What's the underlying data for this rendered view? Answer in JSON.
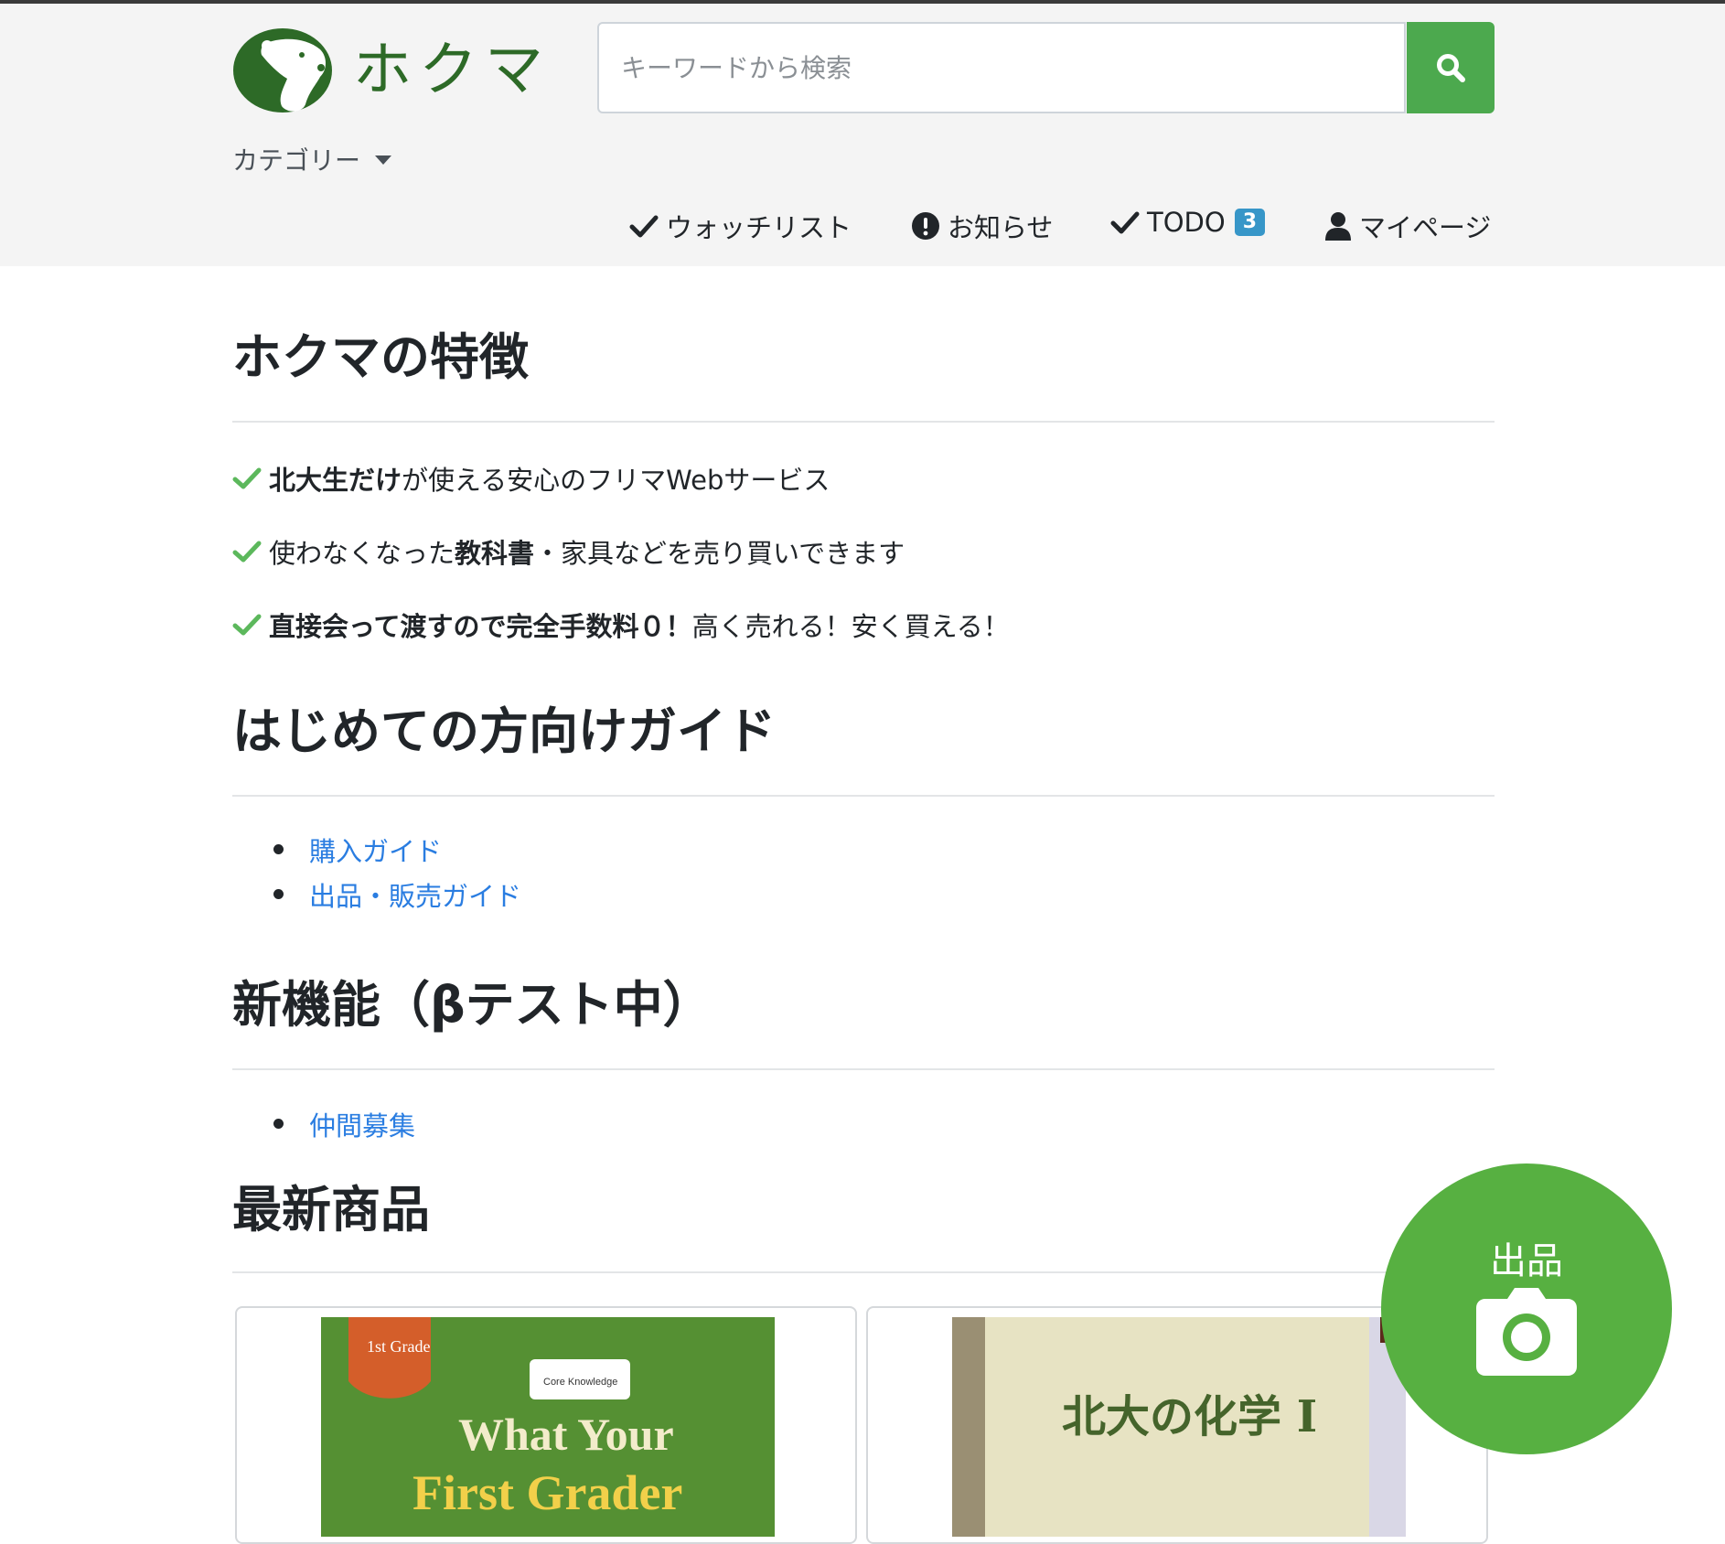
{
  "header": {
    "logo_text": "ホクマ",
    "search_placeholder": "キーワードから検索",
    "search_button_icon": "search-icon",
    "category_label": "カテゴリー"
  },
  "nav": {
    "watchlist": "ウォッチリスト",
    "notices": "お知らせ",
    "todo": "TODO",
    "todo_count": "3",
    "mypage": "マイページ"
  },
  "features": {
    "title": "ホクマの特徴",
    "items": [
      {
        "bold": "北大生だけ",
        "text": "が使える安心のフリマWebサービス"
      },
      {
        "pre": "使わなくなった",
        "bold": "教科書",
        "text": "・家具などを売り買いできます"
      },
      {
        "bold": "直接会って渡すので完全手数料０！",
        "text": "高く売れる！安く買える！"
      }
    ]
  },
  "guide": {
    "title": "はじめての方向けガイド",
    "links": [
      "購入ガイド",
      "出品・販売ガイド"
    ]
  },
  "new_features": {
    "title": "新機能（βテスト中）",
    "links": [
      "仲間募集"
    ]
  },
  "latest": {
    "title": "最新商品",
    "products": [
      {
        "cover_small": "1st Grade",
        "cover_brand": "Core Knowledge",
        "cover_line1": "What Your",
        "cover_line2": "First Grader"
      },
      {
        "cover_title": "北大の化学 I"
      }
    ]
  },
  "fab": {
    "label": "出品",
    "icon": "camera-icon"
  },
  "colors": {
    "brand_green": "#4ca94e",
    "fab_green": "#57b041",
    "link_blue": "#2a7de1",
    "check_green": "#5cb85c",
    "badge_blue": "#3796c8"
  }
}
